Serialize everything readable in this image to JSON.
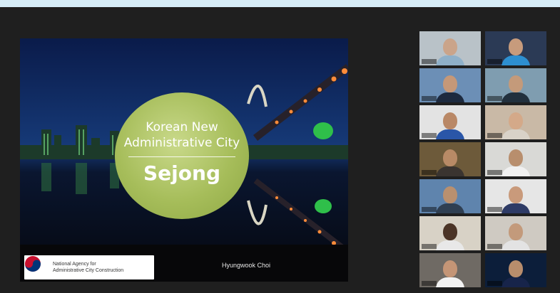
{
  "slide": {
    "title_line1": "Korean New",
    "title_line2": "Administrative City",
    "title_big": "Sejong",
    "agency_line1": "National Agency for",
    "agency_line2": "Administrative City Construction",
    "presenter": "Hyungwook Choi"
  },
  "colors": {
    "page_background": "#d6ecf7",
    "meeting_background": "#1f1f1f",
    "active_speaker_border": "#c8d94a",
    "title_disc": "#a6bd5a"
  },
  "participants": [
    {
      "bg": "#b9c2c8",
      "skin": "#caa48a",
      "shirt": "#8fb0c9"
    },
    {
      "bg": "#2b3a55",
      "skin": "#c79b7c",
      "shirt": "#2d8fd0"
    },
    {
      "bg": "#6c8fb6",
      "skin": "#c59878",
      "shirt": "#1d2a3f"
    },
    {
      "bg": "#7f9db0",
      "skin": "#c49a7a",
      "shirt": "#22303d"
    },
    {
      "bg": "#e3e3e3",
      "skin": "#b98866",
      "shirt": "#2a56a8"
    },
    {
      "bg": "#c9b9a6",
      "skin": "#d4a989",
      "shirt": "#d9d2c8"
    },
    {
      "bg": "#6d5a3a",
      "skin": "#b88a66",
      "shirt": "#3a3430"
    },
    {
      "bg": "#d9d9d6",
      "skin": "#b88e6d",
      "shirt": "#f0f0f0"
    },
    {
      "bg": "#5f84ad",
      "skin": "#b9906f",
      "shirt": "#2f3f52"
    },
    {
      "bg": "#e6e6e6",
      "skin": "#c99a7b",
      "shirt": "#2e3b66"
    },
    {
      "bg": "#d8d2c6",
      "skin": "#4b3426",
      "shirt": "#e8e8e8"
    },
    {
      "bg": "#cfcac2",
      "skin": "#c39a7b",
      "shirt": "#e3e3e3"
    },
    {
      "bg": "#6f6a64",
      "skin": "#c49576",
      "shirt": "#f2f2f2"
    },
    {
      "bg": "#0c1e3a",
      "skin": "#b88d6c",
      "shirt": "#17244a"
    }
  ]
}
